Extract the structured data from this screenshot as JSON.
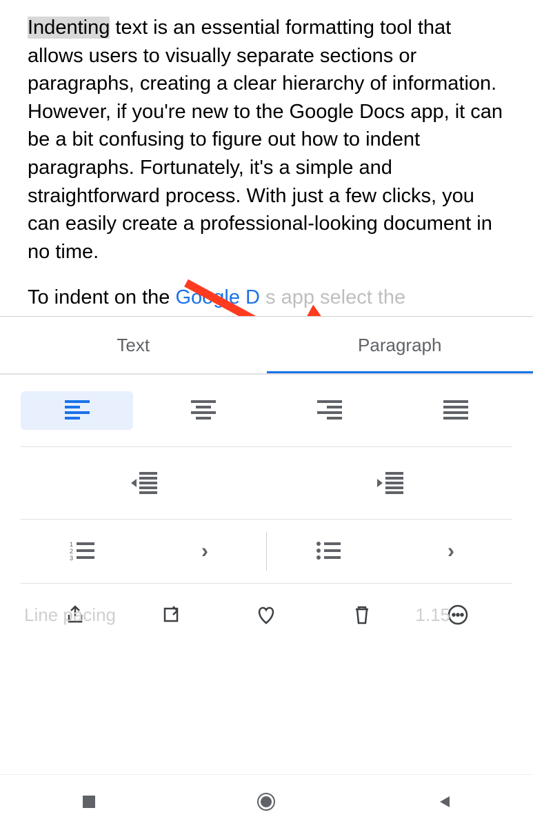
{
  "document": {
    "highlighted_word": "Indenting",
    "paragraph_rest": " text is an essential formatting tool that allows users to visually separate sections or paragraphs, creating a clear hierarchy of information.  However, if you're new to the Google Docs app, it can be a bit confusing to figure out how to indent paragraphs. Fortunately, it's a simple and straightforward process. With just a few clicks, you can easily create a professional-looking document in no time.",
    "partial_line_pre": "To indent on the ",
    "partial_line_link": "Google D",
    "partial_line_post": "s app  select the"
  },
  "tabs": {
    "text": "Text",
    "paragraph": "Paragraph"
  },
  "line_spacing_label": "Line   pacing",
  "line_spacing_value": "1.15"
}
